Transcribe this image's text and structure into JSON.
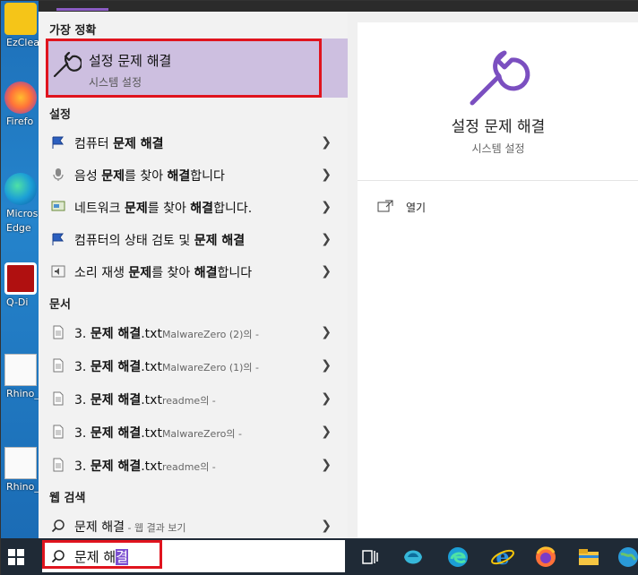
{
  "desktop": {
    "icons": [
      {
        "label": "EzClea"
      },
      {
        "label": "Firefo"
      },
      {
        "label": "Micros Edge"
      },
      {
        "label": "Q-Di"
      },
      {
        "label": "Rhino_7"
      },
      {
        "label": "Rhino_7"
      }
    ]
  },
  "search_panel": {
    "best_match_header": "가장 정확",
    "best_match": {
      "title": "설정 문제 해결",
      "subtitle": "시스템 설정"
    },
    "settings_header": "설정",
    "settings_items": [
      {
        "pre": "컴퓨터 ",
        "hl": "문제 해결",
        "post": "",
        "icon": "flag-icon"
      },
      {
        "pre": "음성 ",
        "hl": "문제",
        "post": "를 찾아 ",
        "hl2": "해결",
        "post2": "합니다",
        "icon": "microphone-icon"
      },
      {
        "pre": "네트워크 ",
        "hl": "문제",
        "post": "를 찾아 ",
        "hl2": "해결",
        "post2": "합니다.",
        "icon": "network-icon"
      },
      {
        "pre": "컴퓨터의 상태 검토 및 ",
        "hl": "문제 해결",
        "post": "",
        "icon": "flag-icon"
      },
      {
        "pre": "소리 재생 ",
        "hl": "문제",
        "post": "를 찾아 ",
        "hl2": "해결",
        "post2": "합니다",
        "icon": "speaker-icon"
      }
    ],
    "documents_header": "문서",
    "documents": [
      {
        "pre": "3. ",
        "hl": "문제 해결",
        "ext": ".txt",
        "meta": "MalwareZero (2)의 -"
      },
      {
        "pre": "3. ",
        "hl": "문제 해결",
        "ext": ".txt",
        "meta": "MalwareZero (1)의 -"
      },
      {
        "pre": "3. ",
        "hl": "문제 해결",
        "ext": ".txt",
        "meta": "readme의 -"
      },
      {
        "pre": "3. ",
        "hl": "문제 해결",
        "ext": ".txt",
        "meta": "MalwareZero의 -"
      },
      {
        "pre": "3. ",
        "hl": "문제 해결",
        "ext": ".txt",
        "meta": "readme의 -"
      }
    ],
    "web_header": "웹 검색",
    "web_item": {
      "text": "문제 해결",
      "meta": " - 웹 결과 보기"
    },
    "chevron": "❯"
  },
  "detail": {
    "title": "설정 문제 해결",
    "subtitle": "시스템 설정",
    "open_label": "열기"
  },
  "taskbar": {
    "search_text_plain": "문제 해",
    "search_text_composing": "결"
  },
  "colors": {
    "accent_purple": "#8b5cc4",
    "highlight_bg": "#cdbfe0",
    "annotation_red": "#e0141e"
  }
}
